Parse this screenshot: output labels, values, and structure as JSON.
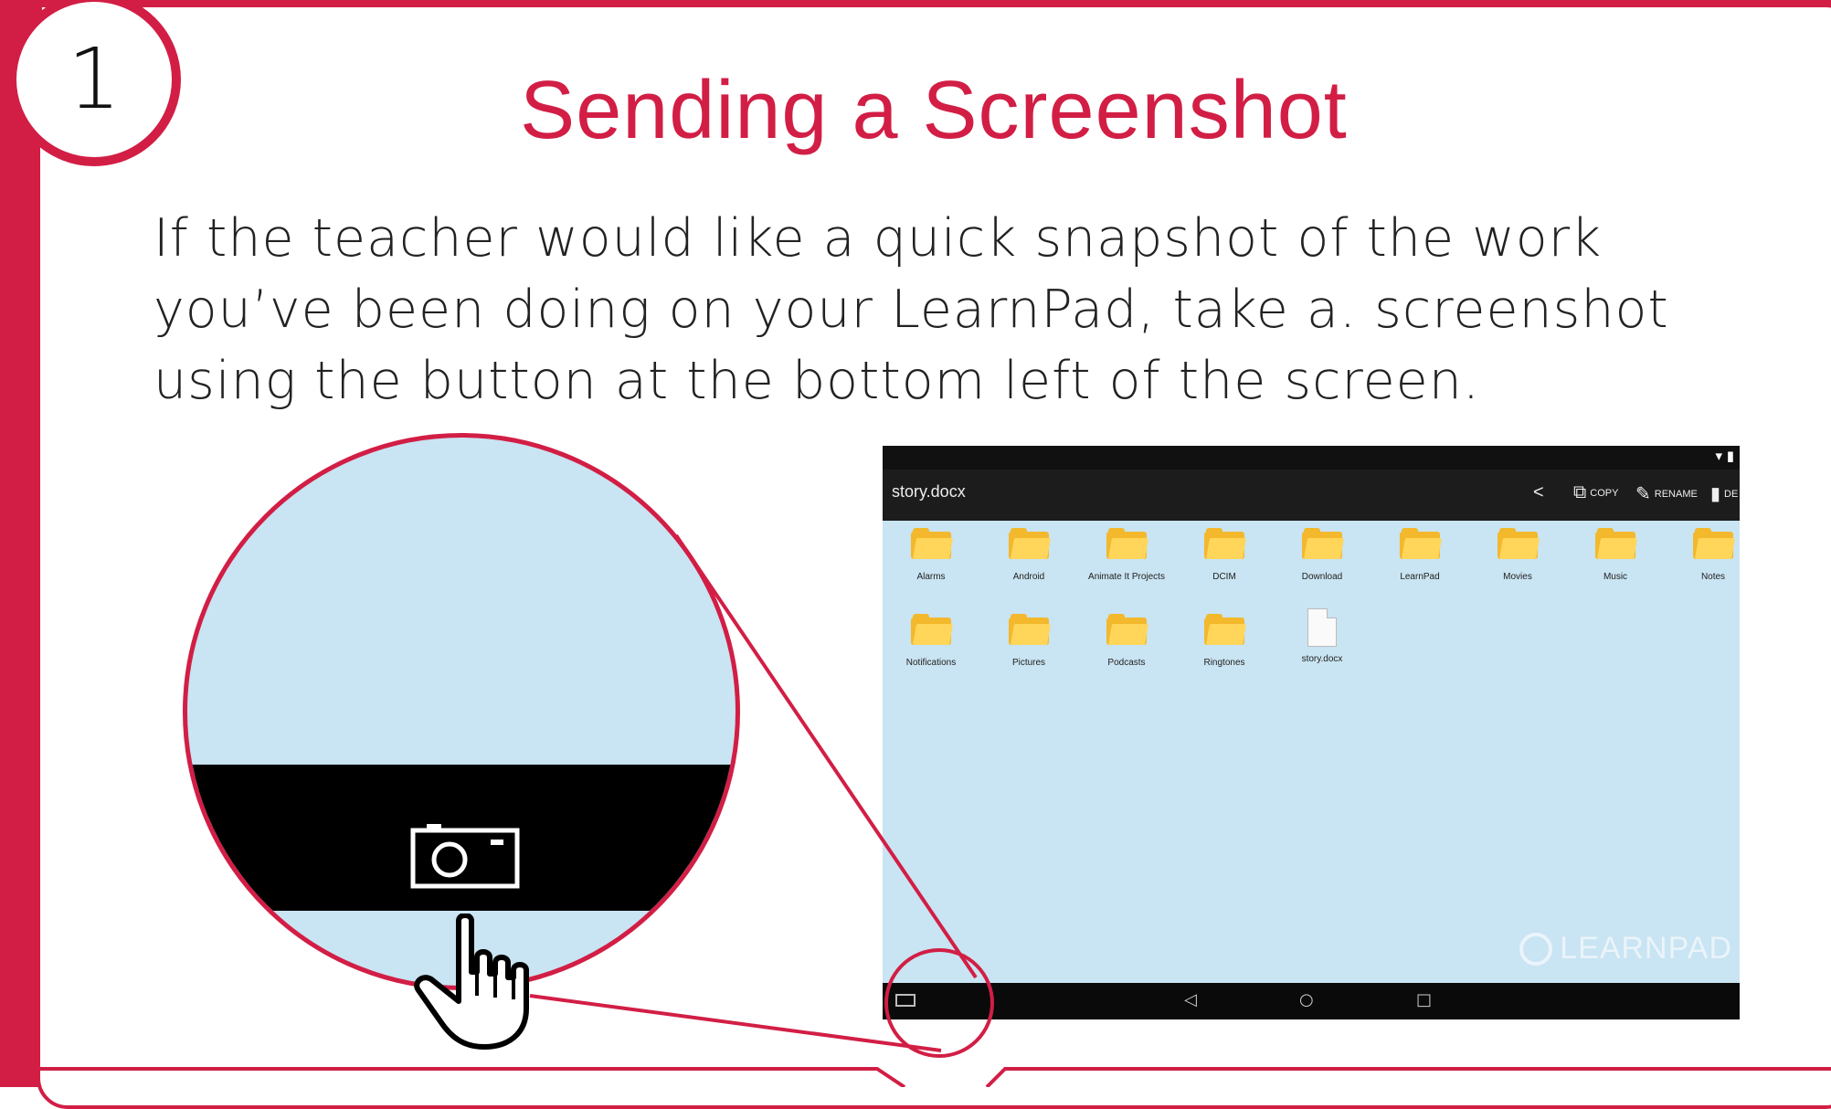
{
  "step": {
    "number": "1"
  },
  "title": "Sending a Screenshot",
  "instructions": "If the teacher would like a quick snapshot of the work you’ve been doing on your LearnPad, take a. screenshot using the button at the bottom left of the screen.",
  "colors": {
    "accent": "#d21e45",
    "screen_bg": "#c9e4f2",
    "bar": "#1c1c1c",
    "folder": "#f3b82c"
  },
  "tablet": {
    "file_title": "story.docx",
    "actions": [
      {
        "icon": "share-icon",
        "label": ""
      },
      {
        "icon": "copy-icon",
        "label": "COPY"
      },
      {
        "icon": "pencil-icon",
        "label": "RENAME"
      },
      {
        "icon": "trash-icon",
        "label": "DE"
      }
    ],
    "files_row1": [
      "Alarms",
      "Android",
      "Animate It Projects",
      "DCIM",
      "Download",
      "LearnPad",
      "Movies",
      "Music",
      "Notes"
    ],
    "files_row2": [
      "Notifications",
      "Pictures",
      "Podcasts",
      "Ringtones"
    ],
    "document_file": "story.docx",
    "watermark": "LEARNPAD",
    "nav_icons": [
      "camera-icon",
      "back-icon",
      "home-icon",
      "recents-icon"
    ]
  },
  "magnifier": {
    "icon": "camera-icon"
  }
}
